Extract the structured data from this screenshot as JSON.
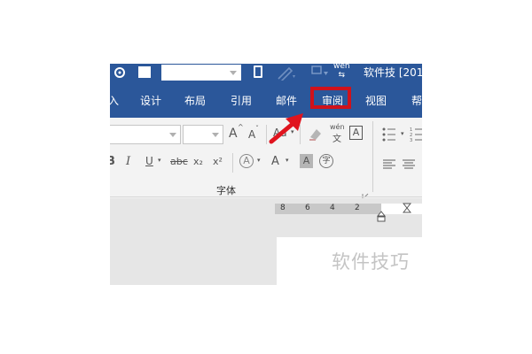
{
  "titlebar": {
    "title_fragment": "软件技 [201"
  },
  "tabs": [
    {
      "label": "入"
    },
    {
      "label": "设计"
    },
    {
      "label": "布局"
    },
    {
      "label": "引用"
    },
    {
      "label": "邮件"
    },
    {
      "label": "审阅"
    },
    {
      "label": "视图"
    },
    {
      "label": "帮"
    }
  ],
  "highlight": {
    "tab": "审阅",
    "box_color": "#d0121b",
    "arrow_color": "#e0141e"
  },
  "font_group": {
    "label": "字体",
    "buttons": {
      "grow": "A",
      "shrink": "A",
      "case": "Aa",
      "phonetic_top": "wén",
      "phonetic_bottom": "文",
      "char_border": "A",
      "bold": "B",
      "italic": "I",
      "underline": "U",
      "strike": "abc",
      "subscript": "x₂",
      "superscript": "x²",
      "text_effect": "A",
      "font_color": "A",
      "shading": "A",
      "enclose": "字"
    }
  },
  "ruler": {
    "numbers": [
      "8",
      "6",
      "4",
      "2"
    ]
  },
  "document": {
    "watermark": "软件技巧"
  },
  "colors": {
    "ribbon_blue": "#2b579a",
    "ribbon_bg": "#f3f3f3",
    "doc_bg": "#e6e6e6"
  }
}
